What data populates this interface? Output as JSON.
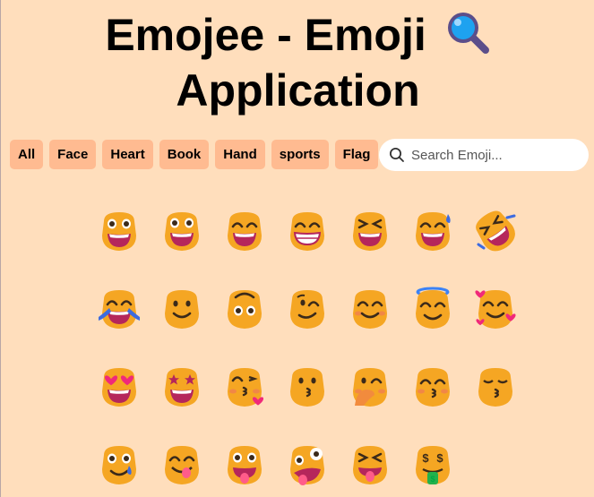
{
  "header": {
    "title_line1": "Emojee - Emoji",
    "title_line2": "Application",
    "title_icon": "magnifier-icon"
  },
  "filters": [
    "All",
    "Face",
    "Heart",
    "Book",
    "Hand",
    "sports",
    "Flag"
  ],
  "search": {
    "placeholder": "Search Emoji...",
    "value": ""
  },
  "emojis": [
    "grinning-face",
    "grinning-face-big-eyes",
    "grinning-face-smiling-eyes",
    "beaming-face",
    "grinning-squinting-face",
    "grinning-face-sweat",
    "rolling-on-floor-laughing",
    "face-with-tears-of-joy",
    "slightly-smiling-face",
    "upside-down-face",
    "winking-face",
    "smiling-face-smiling-eyes",
    "smiling-face-halo",
    "smiling-face-hearts",
    "smiling-face-heart-eyes",
    "star-struck",
    "face-blowing-kiss",
    "kissing-face",
    "face-hand-over-mouth",
    "kissing-face-smiling-eyes",
    "kissing-face-closed-eyes",
    "smiling-face-with-tear",
    "face-savoring-food",
    "face-with-tongue",
    "zany-face",
    "squinting-face-tongue",
    "money-mouth-face",
    ""
  ],
  "colors": {
    "background": "#FFDEBC",
    "chip": "#FFBB91",
    "face": "#F5A623",
    "mouth": "#B5265B",
    "tongue": "#FF5C8A",
    "heart": "#F0297A",
    "halo": "#3B82F6",
    "tear": "#3D6BE0"
  }
}
